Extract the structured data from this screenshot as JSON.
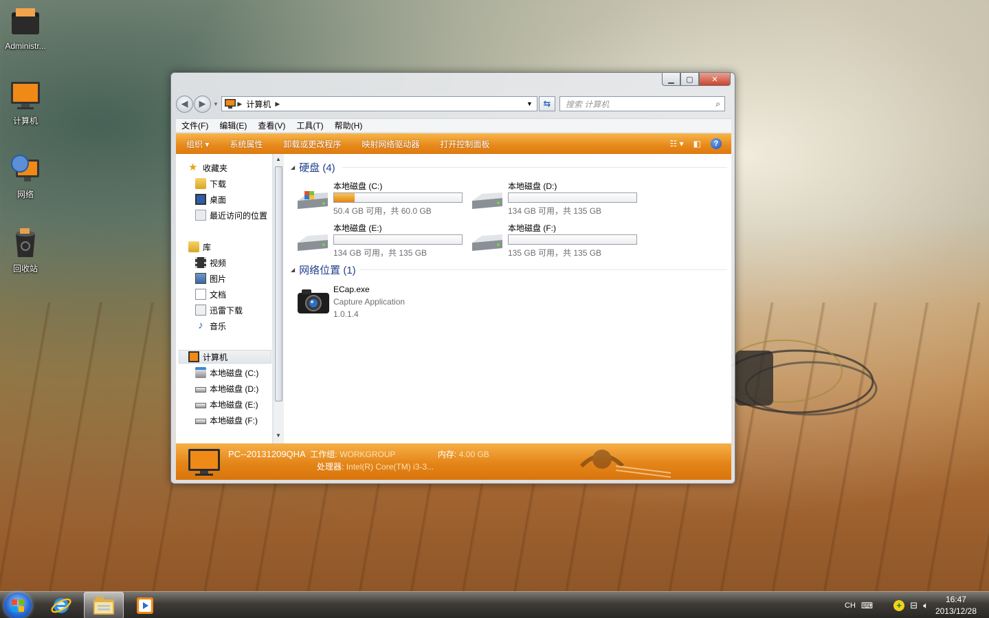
{
  "desktop": {
    "icons": [
      {
        "label": "Administr..."
      },
      {
        "label": "计算机"
      },
      {
        "label": "网络"
      },
      {
        "label": "回收站"
      }
    ]
  },
  "window": {
    "address": {
      "crumb": "计算机"
    },
    "search": {
      "placeholder": "搜索 计算机"
    },
    "menu": [
      "文件(F)",
      "编辑(E)",
      "查看(V)",
      "工具(T)",
      "帮助(H)"
    ],
    "commands": [
      "组织 ▾",
      "系统属性",
      "卸载或更改程序",
      "映射网络驱动器",
      "打开控制面板"
    ],
    "nav": {
      "favorites": {
        "label": "收藏夹",
        "items": [
          "下载",
          "桌面",
          "最近访问的位置"
        ]
      },
      "libraries": {
        "label": "库",
        "items": [
          "视频",
          "图片",
          "文档",
          "迅雷下载",
          "音乐"
        ]
      },
      "computer": {
        "label": "计算机",
        "items": [
          "本地磁盘 (C:)",
          "本地磁盘 (D:)",
          "本地磁盘 (E:)",
          "本地磁盘 (F:)"
        ]
      }
    },
    "groups": {
      "drives_header": "硬盘 (4)",
      "network_header": "网络位置 (1)"
    },
    "drives": [
      {
        "name": "本地磁盘 (C:)",
        "free": "50.4 GB 可用，共 60.0 GB",
        "used_fraction": 0.16
      },
      {
        "name": "本地磁盘 (D:)",
        "free": "134 GB 可用，共 135 GB",
        "used_fraction": 0.0
      },
      {
        "name": "本地磁盘 (E:)",
        "free": "134 GB 可用，共 135 GB",
        "used_fraction": 0.0
      },
      {
        "name": "本地磁盘 (F:)",
        "free": "135 GB 可用，共 135 GB",
        "used_fraction": 0.0
      }
    ],
    "network_item": {
      "name": "ECap.exe",
      "desc": "Capture Application",
      "version": "1.0.1.4"
    },
    "details": {
      "pc_name": "PC--20131209QHA",
      "workgroup_label": "工作组:",
      "workgroup": "WORKGROUP",
      "memory_label": "内存:",
      "memory": "4.00 GB",
      "cpu_label": "处理器:",
      "cpu": "Intel(R) Core(TM) i3-3..."
    }
  },
  "taskbar": {
    "tray_lang": "CH",
    "time": "16:47",
    "date": "2013/12/28"
  },
  "colors": {
    "accent_orange": "#e7891a",
    "group_header_blue": "#1e3f8c"
  }
}
